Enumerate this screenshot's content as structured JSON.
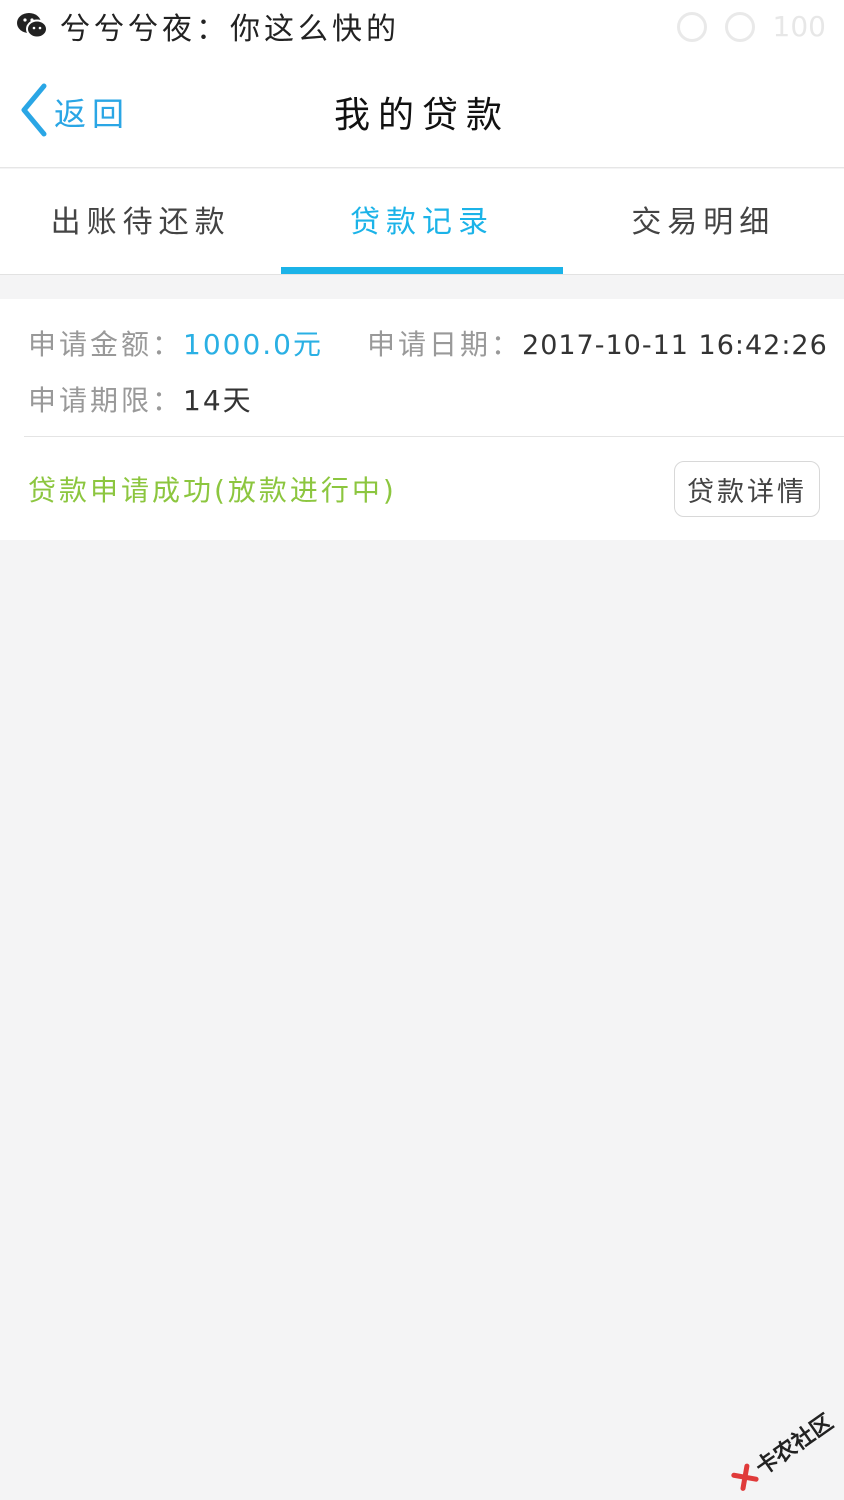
{
  "status_bar": {
    "notification_app_icon": "wechat-icon",
    "notification_text": "兮兮兮夜：你这么快的",
    "battery_text": "100"
  },
  "nav": {
    "back_label": "返回",
    "back_icon": "chevron-left-icon",
    "title": "我的贷款"
  },
  "tabs": [
    {
      "label": "出账待还款",
      "active": false
    },
    {
      "label": "贷款记录",
      "active": true
    },
    {
      "label": "交易明细",
      "active": false
    }
  ],
  "record": {
    "amount_label": "申请金额：",
    "amount_value": "1000.0元",
    "date_label": "申请日期：",
    "date_value": "2017-10-11 16:42:26",
    "term_label": "申请期限：",
    "term_value": "14天",
    "status_text": "贷款申请成功(放款进行中)",
    "detail_button": "贷款详情"
  },
  "watermark": {
    "text": "卡农社区"
  },
  "colors": {
    "accent": "#1bb3e8",
    "back_blue": "#2aa6e5",
    "success_green": "#8cc63f",
    "background": "#f4f4f5"
  }
}
